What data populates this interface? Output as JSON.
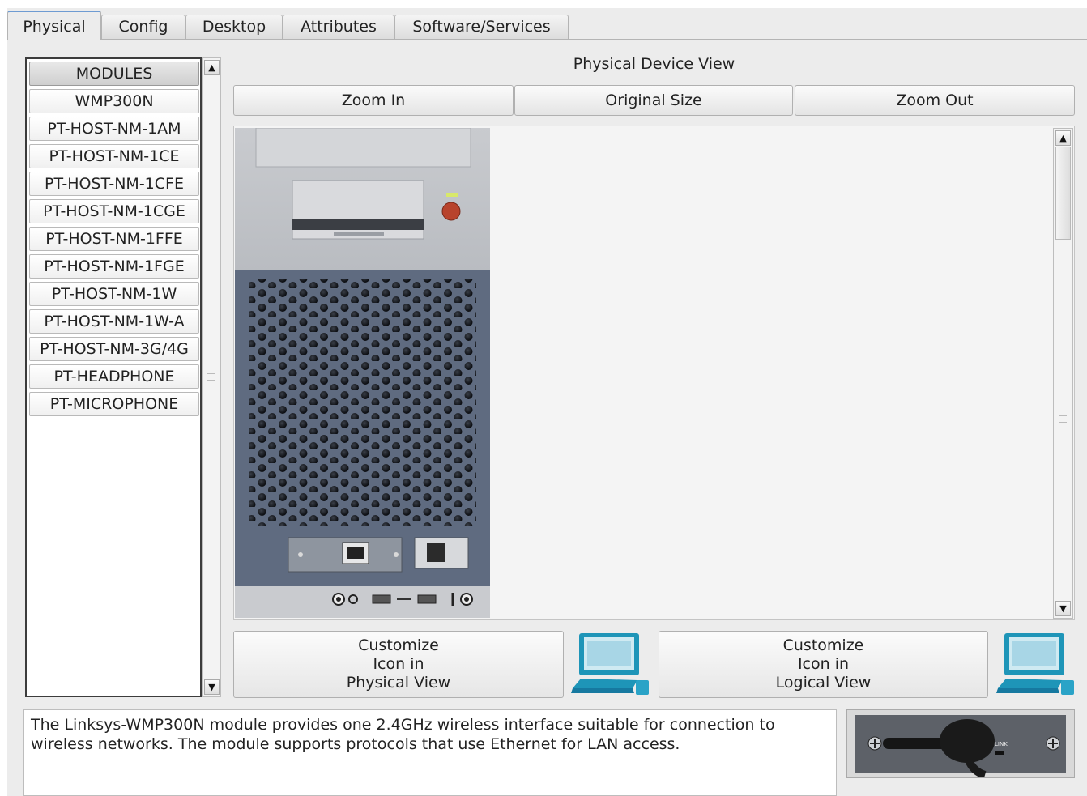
{
  "tabs": [
    {
      "label": "Physical",
      "active": true
    },
    {
      "label": "Config",
      "active": false
    },
    {
      "label": "Desktop",
      "active": false
    },
    {
      "label": "Attributes",
      "active": false
    },
    {
      "label": "Software/Services",
      "active": false
    }
  ],
  "modules": {
    "header": "MODULES",
    "items": [
      "WMP300N",
      "PT-HOST-NM-1AM",
      "PT-HOST-NM-1CE",
      "PT-HOST-NM-1CFE",
      "PT-HOST-NM-1CGE",
      "PT-HOST-NM-1FFE",
      "PT-HOST-NM-1FGE",
      "PT-HOST-NM-1W",
      "PT-HOST-NM-1W-A",
      "PT-HOST-NM-3G/4G",
      "PT-HEADPHONE",
      "PT-MICROPHONE"
    ]
  },
  "physical_view": {
    "title": "Physical Device View",
    "zoom_in": "Zoom In",
    "original_size": "Original Size",
    "zoom_out": "Zoom Out"
  },
  "customize": {
    "physical": [
      "Customize",
      "Icon in",
      "Physical View"
    ],
    "logical": [
      "Customize",
      "Icon in",
      "Logical View"
    ]
  },
  "description": "The Linksys-WMP300N module provides one 2.4GHz wireless interface suitable for connection to wireless networks. The module supports protocols that use Ethernet for LAN access.",
  "module_image_label": "LINK",
  "icons": [
    "pc-tower-image",
    "computer-icon",
    "wireless-module-image"
  ],
  "colors": {
    "accent": "#6e9bd2",
    "tower_panel": "#5f6b80"
  }
}
